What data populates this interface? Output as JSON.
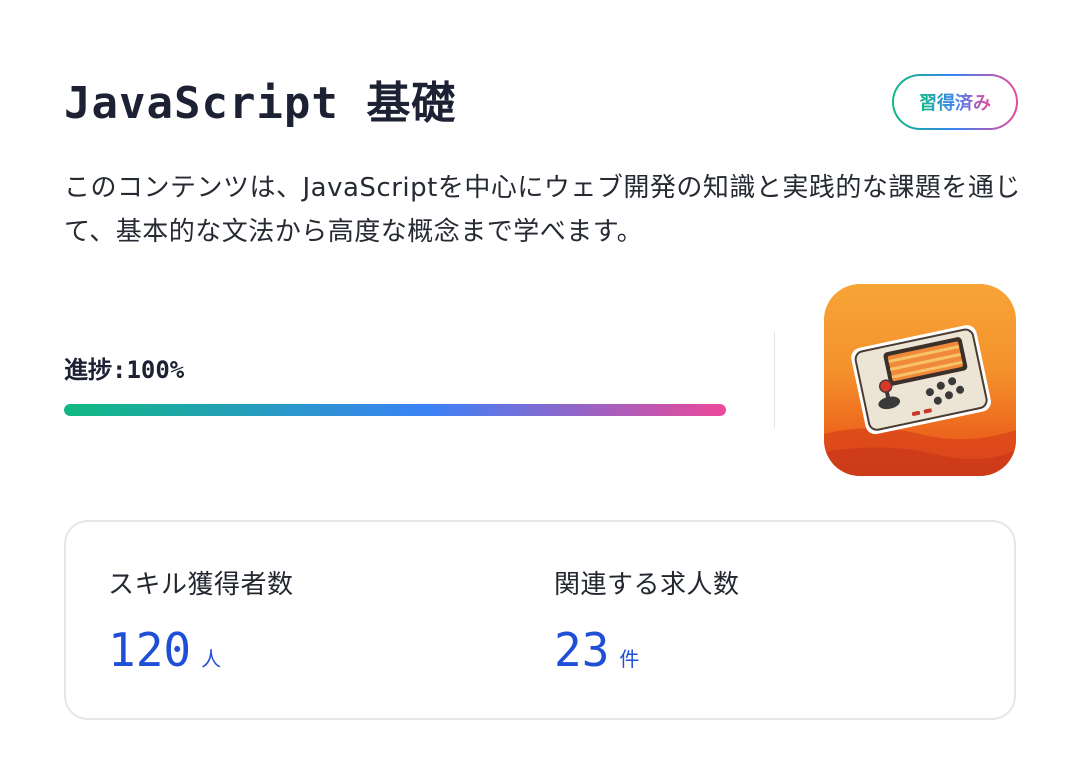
{
  "header": {
    "title": "JavaScript 基礎",
    "badge": "習得済み"
  },
  "description": "このコンテンツは、JavaScriptを中心にウェブ開発の知識と実践的な課題を通じて、基本的な文法から高度な概念まで学べます。",
  "progress": {
    "label": "進捗:100%",
    "value": 100
  },
  "thumbnail": {
    "icon": "retro-game-console-icon"
  },
  "stats": [
    {
      "label": "スキル獲得者数",
      "value": "120",
      "unit": "人"
    },
    {
      "label": "関連する求人数",
      "value": "23",
      "unit": "件"
    }
  ],
  "colors": {
    "accent_blue": "#1f4fd6",
    "gradient_start": "#10b981",
    "gradient_mid": "#3b82f6",
    "gradient_end": "#ec4899"
  }
}
